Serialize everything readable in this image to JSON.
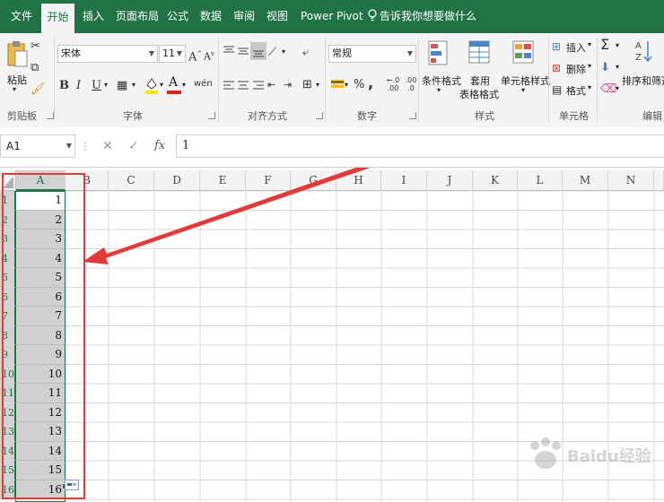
{
  "tabs": [
    "文件",
    "开始",
    "插入",
    "页面布局",
    "公式",
    "数据",
    "审阅",
    "视图",
    "Power Pivot",
    "告诉我你想要做什么"
  ],
  "active_tab": "开始",
  "ribbon": {
    "clipboard": {
      "paste": "粘贴",
      "group": "剪贴板"
    },
    "font": {
      "name": "宋体",
      "size": "11",
      "group": "字体",
      "bold": "B",
      "italic": "I",
      "underline": "U",
      "grow": "A",
      "shrink": "A",
      "font_color": "A"
    },
    "alignment": {
      "group": "对齐方式"
    },
    "number": {
      "format": "常规",
      "group": "数字",
      "percent": "%",
      "comma": ",",
      "inc_dec": ".00",
      "dec_dec": ".0"
    },
    "styles": {
      "group": "样式",
      "cond_format": "条件格式",
      "table_format_1": "套用",
      "table_format_2": "表格格式",
      "cell_styles": "单元格样式"
    },
    "cells": {
      "group": "单元格",
      "insert": "插入",
      "delete": "删除",
      "format": "格式"
    },
    "editing": {
      "group": "编辑",
      "sort_filter": "排序和筛选",
      "sigma": "Σ"
    }
  },
  "formula_bar": {
    "name_box": "A1",
    "fx": "fx",
    "cancel": "✕",
    "enter": "✓",
    "value": "1"
  },
  "columns": [
    "A",
    "B",
    "C",
    "D",
    "E",
    "F",
    "G",
    "H",
    "I",
    "J",
    "K",
    "L",
    "M",
    "N"
  ],
  "selected_column": "A",
  "rows": [
    "1",
    "2",
    "3",
    "4",
    "5",
    "6",
    "7",
    "8",
    "9",
    "10",
    "11",
    "12",
    "13",
    "14",
    "15",
    "16"
  ],
  "cells_A": [
    "1",
    "2",
    "3",
    "4",
    "5",
    "6",
    "7",
    "8",
    "9",
    "10",
    "11",
    "12",
    "13",
    "14",
    "15",
    "16"
  ],
  "colors": {
    "excel_green": "#217346",
    "annotation_red": "#e03a3a"
  },
  "watermark": "Baidu经验"
}
